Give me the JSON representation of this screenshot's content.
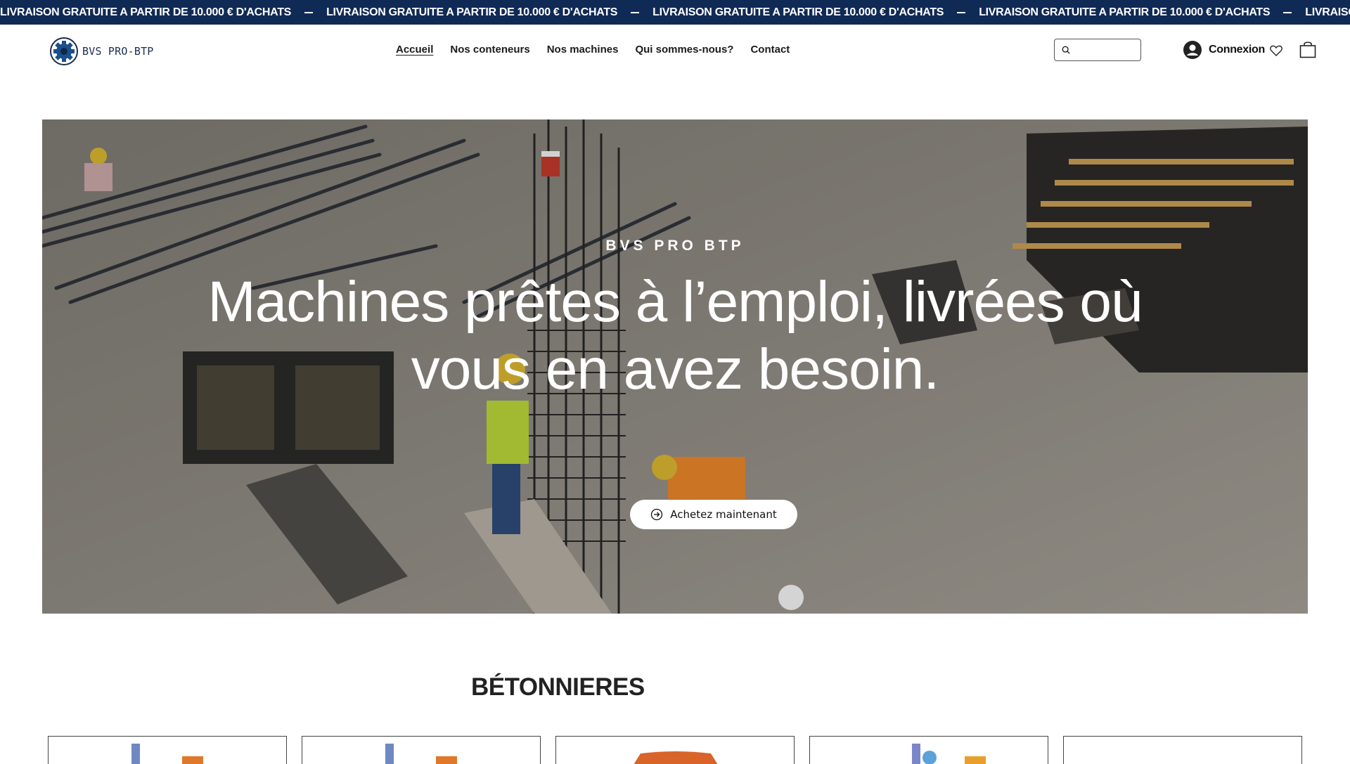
{
  "announcement": {
    "text": "LIVRAISON GRATUITE A PARTIR DE 10.000 € D'ACHATS",
    "repeat": 5
  },
  "header": {
    "logo_text": "BVS PRO-BTP",
    "nav": [
      {
        "label": "Accueil",
        "active": true
      },
      {
        "label": "Nos conteneurs",
        "active": false
      },
      {
        "label": "Nos machines",
        "active": false
      },
      {
        "label": "Qui sommes-nous?",
        "active": false
      },
      {
        "label": "Contact",
        "active": false
      }
    ],
    "search_placeholder": "",
    "login_label": "Connexion",
    "icons": {
      "search": "search-icon",
      "account": "account-icon",
      "wishlist": "heart-icon",
      "cart": "cart-icon"
    }
  },
  "hero": {
    "eyebrow": "BVS PRO BTP",
    "title": "Machines prêtes à l’emploi, livrées où vous en avez besoin.",
    "cta_label": "Achetez maintenant",
    "cta_icon": "arrow-circle-right-icon"
  },
  "section": {
    "title": "BÉTONNIERES"
  },
  "colors": {
    "announce_bg": "#102a56",
    "text": "#111111"
  }
}
